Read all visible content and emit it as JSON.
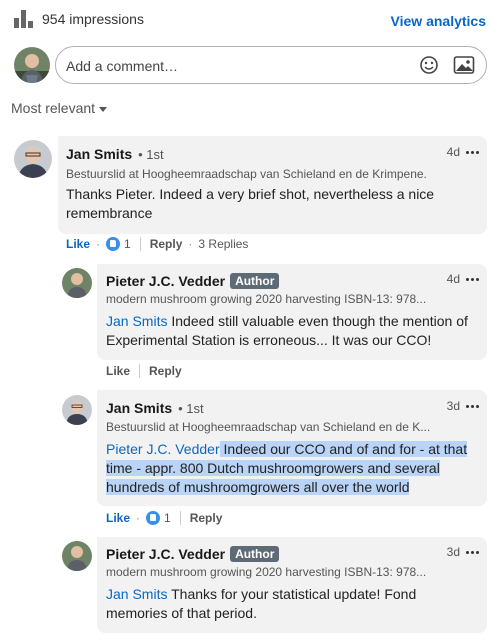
{
  "header": {
    "impressions": "954 impressions",
    "view_analytics": "View analytics"
  },
  "composer": {
    "placeholder": "Add a comment…"
  },
  "sort": {
    "label": "Most relevant"
  },
  "comments": [
    {
      "name": "Jan Smits",
      "degree": "• 1st",
      "headline": "Bestuurslid at Hoogheemraadschap van Schieland en de Krimpene...",
      "time": "4d",
      "text": "Thanks Pieter. Indeed a very brief shot, nevertheless a nice remembrance",
      "actions": {
        "like": "Like",
        "count": "1",
        "reply": "Reply",
        "replies": "3 Replies"
      }
    },
    {
      "name": "Pieter J.C. Vedder",
      "badge": "Author",
      "headline": "modern mushroom growing 2020 harvesting ISBN-13: 978...",
      "time": "4d",
      "mention": "Jan Smits",
      "text": " Indeed still valuable even though the mention of Experimental Station is erroneous... It was our CCO!",
      "actions": {
        "like": "Like",
        "reply": "Reply"
      }
    },
    {
      "name": "Jan Smits",
      "degree": "• 1st",
      "headline": "Bestuurslid at Hoogheemraadschap van Schieland en de K...",
      "time": "3d",
      "mention": "Pieter J.C. Vedder",
      "text": " Indeed our CCO and of and for - at that time - appr. 800 Dutch mushroomgrowers and several hundreds of mushroomgrowers all over the world",
      "actions": {
        "like": "Like",
        "count": "1",
        "reply": "Reply"
      }
    },
    {
      "name": "Pieter J.C. Vedder",
      "badge": "Author",
      "headline": "modern mushroom growing 2020 harvesting ISBN-13: 978...",
      "time": "3d",
      "mention": "Jan Smits",
      "text": " Thanks for your statistical update! Fond memories of that period."
    }
  ],
  "colors": {
    "accent": "#0a66c2",
    "bubble": "#f2f2f2",
    "highlight": "#b9d4f6",
    "author_badge": "#5e6a75"
  },
  "icons": [
    "bar-chart-icon",
    "emoji-icon",
    "image-icon",
    "chevron-down-icon",
    "more-icon",
    "like-reaction-icon"
  ]
}
